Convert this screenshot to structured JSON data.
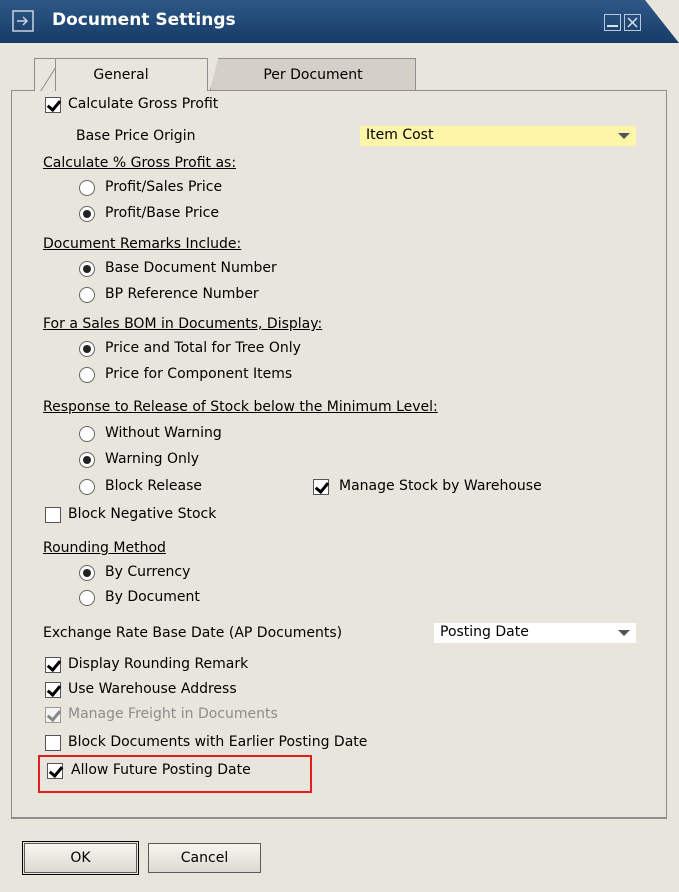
{
  "window": {
    "title": "Document Settings"
  },
  "tabs": [
    {
      "label": "General",
      "active": true
    },
    {
      "label": "Per Document",
      "active": false
    }
  ],
  "settings": {
    "calculate_gross_profit": {
      "label": "Calculate Gross Profit",
      "checked": true
    },
    "base_price_origin": {
      "label": "Base Price Origin",
      "value": "Item Cost"
    },
    "gross_profit_as": {
      "heading": "Calculate % Gross Profit as:",
      "options": [
        {
          "label": "Profit/Sales Price",
          "selected": false
        },
        {
          "label": "Profit/Base Price",
          "selected": true
        }
      ]
    },
    "remarks_include": {
      "heading": "Document Remarks Include:",
      "options": [
        {
          "label": "Base Document Number",
          "selected": true
        },
        {
          "label": "BP Reference Number",
          "selected": false
        }
      ]
    },
    "sales_bom": {
      "heading": "For a Sales BOM in Documents, Display:",
      "options": [
        {
          "label": "Price and Total for Tree Only",
          "selected": true
        },
        {
          "label": "Price for Component Items",
          "selected": false
        }
      ]
    },
    "stock_release": {
      "heading": "Response to Release of Stock below the Minimum Level:",
      "options": [
        {
          "label": "Without Warning",
          "selected": false
        },
        {
          "label": "Warning Only",
          "selected": true
        },
        {
          "label": "Block Release",
          "selected": false
        }
      ]
    },
    "manage_stock_by_warehouse": {
      "label": "Manage Stock by Warehouse",
      "checked": true
    },
    "block_negative_stock": {
      "label": "Block Negative Stock",
      "checked": false
    },
    "rounding_method": {
      "heading": "Rounding Method",
      "options": [
        {
          "label": "By Currency",
          "selected": true
        },
        {
          "label": "By Document",
          "selected": false
        }
      ]
    },
    "exchange_rate_base_date": {
      "label": "Exchange Rate Base Date (AP Documents)",
      "value": "Posting Date"
    },
    "display_rounding_remark": {
      "label": "Display Rounding Remark",
      "checked": true
    },
    "use_warehouse_address": {
      "label": "Use Warehouse Address",
      "checked": true
    },
    "manage_freight": {
      "label": "Manage Freight in Documents",
      "checked": true,
      "disabled": true
    },
    "block_earlier_posting": {
      "label": "Block Documents with Earlier Posting Date",
      "checked": false
    },
    "allow_future_posting": {
      "label": "Allow Future Posting Date",
      "checked": true
    }
  },
  "buttons": {
    "ok": "OK",
    "cancel": "Cancel"
  },
  "colors": {
    "titlebar": "#1e4675",
    "dialog_bg": "#e8e6dc",
    "mandatory_field": "#fdf6a8",
    "highlight": "#e02020"
  }
}
